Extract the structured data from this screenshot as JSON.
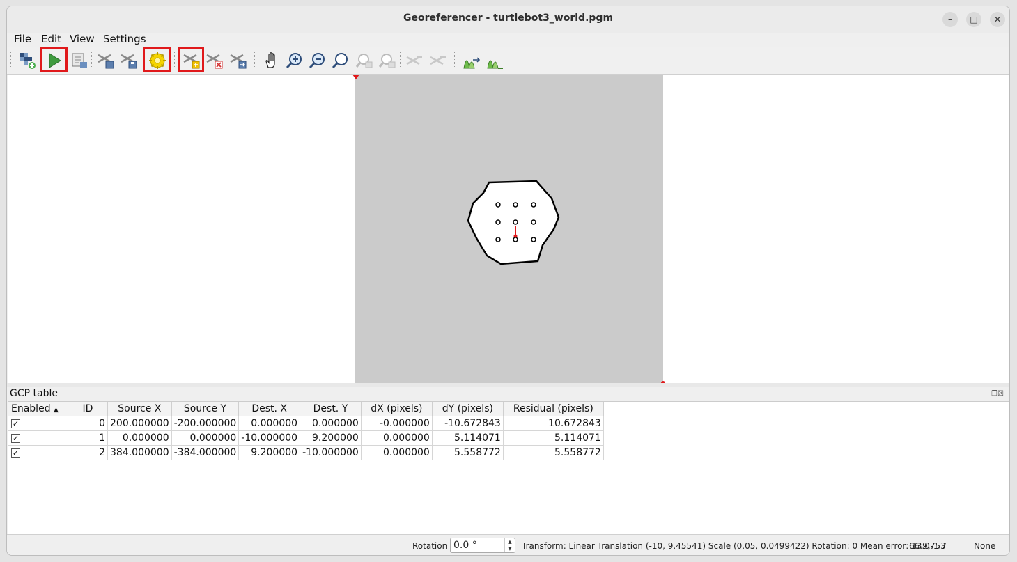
{
  "window": {
    "title": "Georeferencer - turtlebot3_world.pgm",
    "controls": {
      "minimize": "–",
      "maximize": "□",
      "close": "✕"
    }
  },
  "menu": [
    "File",
    "Edit",
    "View",
    "Settings"
  ],
  "toolbar": {
    "buttons": [
      "open-raster-icon",
      "start-georeferencing-icon",
      "generate-gdal-script-icon",
      "load-gcp-points-icon",
      "save-gcp-points-icon",
      "transformation-settings-icon",
      "add-point-icon",
      "delete-point-icon",
      "move-gcp-point-icon",
      "pan-icon",
      "zoom-in-icon",
      "zoom-out-icon",
      "zoom-to-layer-icon",
      "zoom-last-icon",
      "zoom-next-icon",
      "link-georef-to-qgis-icon",
      "link-qgis-to-georef-icon",
      "full-histogram-stretch-icon",
      "local-histogram-stretch-icon"
    ],
    "highlighted": [
      "start-georeferencing-icon",
      "transformation-settings-icon",
      "add-point-icon"
    ],
    "highlight_color": "#e0191b"
  },
  "canvas": {
    "raster_color": "#cbcbcb",
    "marker_color": "#e0191b"
  },
  "gcp_table": {
    "title": "GCP table",
    "columns": [
      "Enabled",
      "ID",
      "Source X",
      "Source Y",
      "Dest. X",
      "Dest. Y",
      "dX (pixels)",
      "dY (pixels)",
      "Residual (pixels)"
    ],
    "sort_indicator": "▲",
    "rows": [
      {
        "enabled": "✓",
        "id": "0",
        "source_x": "200.000000",
        "source_y": "-200.000000",
        "dest_x": "0.000000",
        "dest_y": "0.000000",
        "dx": "-0.000000",
        "dy": "-10.672843",
        "residual": "10.672843"
      },
      {
        "enabled": "✓",
        "id": "1",
        "source_x": "0.000000",
        "source_y": "0.000000",
        "dest_x": "-10.000000",
        "dest_y": "9.200000",
        "dx": "0.000000",
        "dy": "5.114071",
        "residual": "5.114071"
      },
      {
        "enabled": "✓",
        "id": "2",
        "source_x": "384.000000",
        "source_y": "-384.000000",
        "dest_x": "9.200000",
        "dest_y": "-10.000000",
        "dx": "0.000000",
        "dy": "5.558772",
        "residual": "5.558772"
      }
    ]
  },
  "status": {
    "rotation_label": "Rotation",
    "rotation_value": "0.0 °",
    "transform": "Transform: Linear Translation (-10, 9.45541) Scale (0.05, 0.0499422) Rotation: 0 Mean error: 13.0753",
    "coords": "66.9,-1.7",
    "crs": "None"
  }
}
